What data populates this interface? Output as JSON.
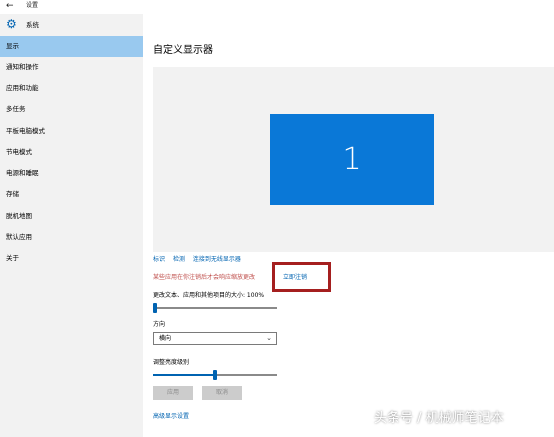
{
  "window": {
    "back_icon": "back-arrow-icon",
    "title": "设置"
  },
  "sidebar": {
    "header_icon": "gear-icon",
    "header_label": "系统",
    "items": [
      {
        "label": "显示",
        "active": true
      },
      {
        "label": "通知和操作",
        "active": false
      },
      {
        "label": "应用和功能",
        "active": false
      },
      {
        "label": "多任务",
        "active": false
      },
      {
        "label": "平板电脑模式",
        "active": false
      },
      {
        "label": "节电模式",
        "active": false
      },
      {
        "label": "电源和睡眠",
        "active": false
      },
      {
        "label": "存储",
        "active": false
      },
      {
        "label": "脱机地图",
        "active": false
      },
      {
        "label": "默认应用",
        "active": false
      },
      {
        "label": "关于",
        "active": false
      }
    ]
  },
  "main": {
    "title": "自定义显示器",
    "monitor_number": "1",
    "links": [
      "标识",
      "检测",
      "连接到无线显示器"
    ],
    "warning": "某些应用在你注销后才会响应缩放更改",
    "logout_link": "立即注销",
    "scale_label": "更改文本、应用和其他项目的大小: 100%",
    "scale_value": 0,
    "orientation_label": "方向",
    "orientation_value": "横向",
    "brightness_label": "调整亮度级别",
    "brightness_value": 0.5,
    "apply_button": "应用",
    "cancel_button": "取消",
    "advanced_link": "高级显示设置"
  },
  "watermark": "头条号 / 机械师笔记本",
  "colors": {
    "accent": "#0063b1",
    "monitor": "#0a78d7",
    "active_nav": "#99c9ef",
    "highlight_box": "#a51f1f",
    "warning_text": "#c0504d"
  }
}
